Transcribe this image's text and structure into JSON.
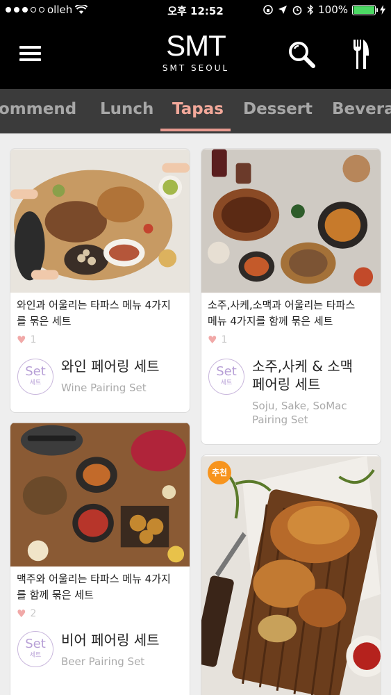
{
  "status_bar": {
    "carrier": "olleh",
    "time": "오후 12:52",
    "battery_text": "100%",
    "battery_level": 1.0
  },
  "header": {
    "logo_mark": "SMT",
    "logo_sub": "SMT SEOUL"
  },
  "tabs": {
    "items": [
      {
        "label": "ommend"
      },
      {
        "label": "Lunch"
      },
      {
        "label": "Tapas"
      },
      {
        "label": "Dessert"
      },
      {
        "label": "Beverag"
      }
    ],
    "active_index": 2
  },
  "menu": {
    "items": [
      {
        "desc_line1": "와인과 어울리는 타파스 메뉴 4가지",
        "desc_line2": "를 묶은 세트",
        "likes": "1",
        "badge_top": "Set",
        "badge_bottom": "세트",
        "name_line1": "와인 페어링 세트",
        "sub_line1": "Wine Pairing Set"
      },
      {
        "desc_line1": "소주,사케,소맥과 어울리는 타파스",
        "desc_line2": "메뉴 4가지를 함께 묶은 세트",
        "likes": "1",
        "badge_top": "Set",
        "badge_bottom": "세트",
        "name_line1": "소주,사케 & 소맥",
        "name_line2": "페어링 세트",
        "sub_line1": "Soju, Sake, SoMac",
        "sub_line2": "Pairing Set"
      },
      {
        "desc_line1": "맥주와 어울리는 타파스 메뉴 4가지",
        "desc_line2": "를 함께 묶은 세트",
        "likes": "2",
        "badge_top": "Set",
        "badge_bottom": "세트",
        "name_line1": "비어 페어링 세트",
        "sub_line1": "Beer Pairing Set"
      },
      {
        "recommend_badge": "추천"
      }
    ]
  },
  "colors": {
    "accent_tab": "#f2a89a",
    "badge_purple": "#b79fd6",
    "recommend_orange": "#f7941d",
    "heart": "#f1a9a8"
  }
}
